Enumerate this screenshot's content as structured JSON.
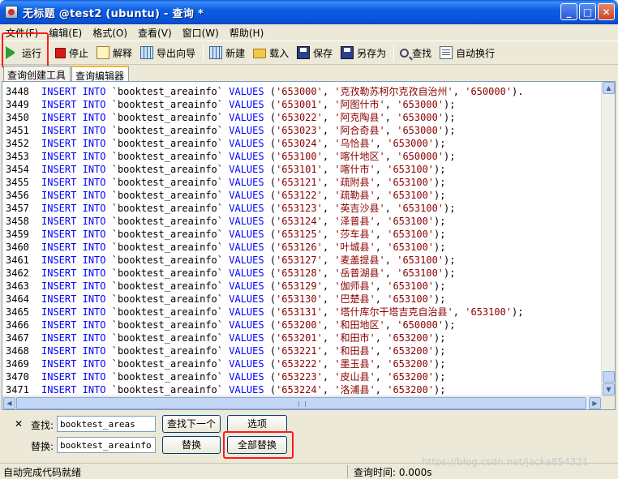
{
  "window": {
    "title": "无标题 @test2 (ubuntu) - 查询 *"
  },
  "menu": [
    "文件(F)",
    "编辑(E)",
    "格式(O)",
    "查看(V)",
    "窗口(W)",
    "帮助(H)"
  ],
  "toolbar": {
    "run": "运行",
    "stop": "停止",
    "explain": "解释",
    "export": "导出向导",
    "new": "新建",
    "load": "载入",
    "save": "保存",
    "saveas": "另存为",
    "find": "查找",
    "wrap": "自动换行"
  },
  "tabs": [
    "查询创建工具",
    "查询编辑器"
  ],
  "editor": {
    "rows": [
      {
        "n": "3448",
        "code": "'653000'",
        "name": "克孜勒苏柯尔克孜自治州",
        "parent": "'650000'",
        "tail": ")."
      },
      {
        "n": "3449",
        "code": "'653001'",
        "name": "阿图什市",
        "parent": "'653000'",
        "tail": ");"
      },
      {
        "n": "3450",
        "code": "'653022'",
        "name": "阿克陶县",
        "parent": "'653000'",
        "tail": ");"
      },
      {
        "n": "3451",
        "code": "'653023'",
        "name": "阿合奇县",
        "parent": "'653000'",
        "tail": ");"
      },
      {
        "n": "3452",
        "code": "'653024'",
        "name": "乌恰县",
        "parent": "'653000'",
        "tail": ");"
      },
      {
        "n": "3453",
        "code": "'653100'",
        "name": "喀什地区",
        "parent": "'650000'",
        "tail": ");"
      },
      {
        "n": "3454",
        "code": "'653101'",
        "name": "喀什市",
        "parent": "'653100'",
        "tail": ");"
      },
      {
        "n": "3455",
        "code": "'653121'",
        "name": "疏附县",
        "parent": "'653100'",
        "tail": ");"
      },
      {
        "n": "3456",
        "code": "'653122'",
        "name": "疏勒县",
        "parent": "'653100'",
        "tail": ");"
      },
      {
        "n": "3457",
        "code": "'653123'",
        "name": "英吉沙县",
        "parent": "'653100'",
        "tail": ");"
      },
      {
        "n": "3458",
        "code": "'653124'",
        "name": "泽普县",
        "parent": "'653100'",
        "tail": ");"
      },
      {
        "n": "3459",
        "code": "'653125'",
        "name": "莎车县",
        "parent": "'653100'",
        "tail": ");"
      },
      {
        "n": "3460",
        "code": "'653126'",
        "name": "叶城县",
        "parent": "'653100'",
        "tail": ");"
      },
      {
        "n": "3461",
        "code": "'653127'",
        "name": "麦盖提县",
        "parent": "'653100'",
        "tail": ");"
      },
      {
        "n": "3462",
        "code": "'653128'",
        "name": "岳普湖县",
        "parent": "'653100'",
        "tail": ");"
      },
      {
        "n": "3463",
        "code": "'653129'",
        "name": "伽师县",
        "parent": "'653100'",
        "tail": ");"
      },
      {
        "n": "3464",
        "code": "'653130'",
        "name": "巴楚县",
        "parent": "'653100'",
        "tail": ");"
      },
      {
        "n": "3465",
        "code": "'653131'",
        "name": "塔什库尔干塔吉克自治县",
        "parent": "'653100'",
        "tail": ");"
      },
      {
        "n": "3466",
        "code": "'653200'",
        "name": "和田地区",
        "parent": "'650000'",
        "tail": ");"
      },
      {
        "n": "3467",
        "code": "'653201'",
        "name": "和田市",
        "parent": "'653200'",
        "tail": ");"
      },
      {
        "n": "3468",
        "code": "'653221'",
        "name": "和田县",
        "parent": "'653200'",
        "tail": ");"
      },
      {
        "n": "3469",
        "code": "'653222'",
        "name": "墨玉县",
        "parent": "'653200'",
        "tail": ");"
      },
      {
        "n": "3470",
        "code": "'653223'",
        "name": "皮山县",
        "parent": "'653200'",
        "tail": ");"
      },
      {
        "n": "3471",
        "code": "'653224'",
        "name": "洛浦县",
        "parent": "'653200'",
        "tail": ");"
      }
    ],
    "kw_insert": "INSERT",
    "kw_into": "INTO",
    "table": "`booktest_areainfo`",
    "kw_values": "VALUES"
  },
  "find": {
    "close": "✕",
    "find_label": "查找:",
    "find_value": "booktest_areas",
    "replace_label": "替换:",
    "replace_value": "booktest_areainfo",
    "find_next": "查找下一个",
    "options": "选项",
    "replace": "替换",
    "replace_all": "全部替换"
  },
  "status": {
    "left": "自动完成代码就绪",
    "time": "查询时间: 0.000s",
    "watermark": "https://blog.csdn.net/jacka854321"
  }
}
